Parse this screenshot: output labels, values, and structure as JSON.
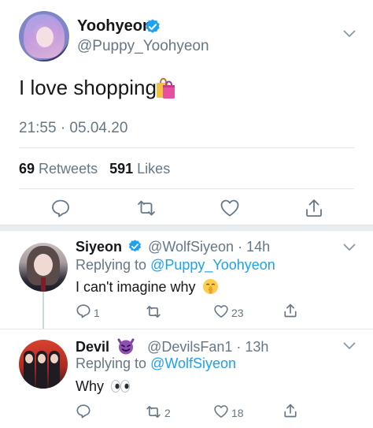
{
  "main_tweet": {
    "name": "Yoohyeon",
    "handle": "@Puppy_Yoohyeon",
    "text": "I love shopping",
    "timestamp": "21:55 · 05.04.20",
    "retweets_count": "69",
    "retweets_label": "Retweets",
    "likes_count": "591",
    "likes_label": "Likes",
    "emoji": "shopping-bags-icon"
  },
  "replies": [
    {
      "name": "Siyeon",
      "verified": true,
      "handle": "@WolfSiyeon",
      "time": "· 14h",
      "replying_prefix": "Replying to",
      "replying_to": "@Puppy_Yoohyeon",
      "text": "I can't imagine why",
      "emoji": "shushing-face-icon",
      "reply_count": "1",
      "retweet_count": "",
      "like_count": "23"
    },
    {
      "name": "Devil",
      "verified": false,
      "handle": "@DevilsFan1",
      "time": "· 13h",
      "replying_prefix": "Replying to",
      "replying_to": "@WolfSiyeon",
      "text": "Why",
      "emoji": "eyes-icon",
      "reply_count": "",
      "retweet_count": "2",
      "like_count": "18"
    }
  ],
  "colors": {
    "text": "#14171a",
    "secondary": "#657786",
    "link": "#1da1f2",
    "divider": "#e1e8ed",
    "verified": "#1da1f2",
    "devil_emoji": "#7b3fa0"
  }
}
